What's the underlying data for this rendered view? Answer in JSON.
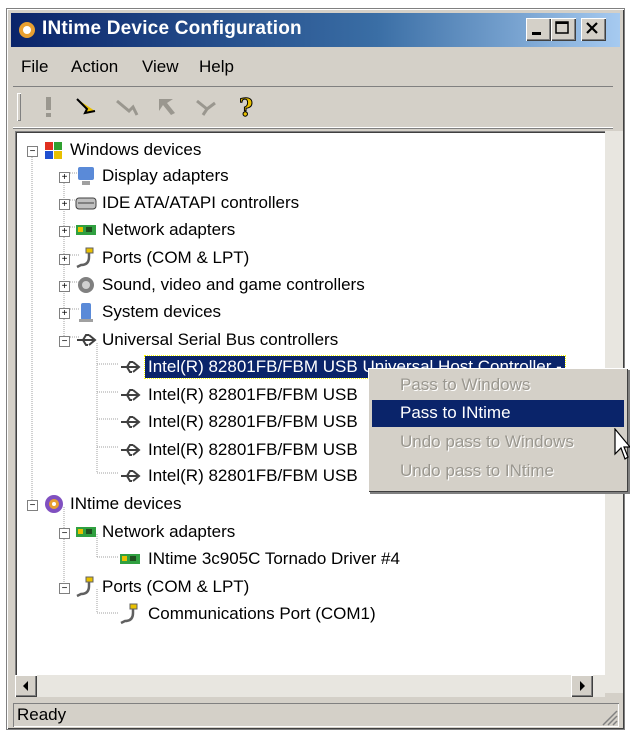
{
  "window": {
    "title": "INtime Device Configuration"
  },
  "menu": {
    "items": [
      "File",
      "Action",
      "View",
      "Help"
    ]
  },
  "toolbar": {
    "buttons": [
      "properties-icon",
      "enable-icon",
      "disable-icon",
      "back-icon",
      "forward-icon",
      "help-icon"
    ]
  },
  "tree": {
    "windows_root": "Windows devices",
    "display": "Display adapters",
    "ide": "IDE ATA/ATAPI controllers",
    "network": "Network adapters",
    "ports": "Ports (COM & LPT)",
    "sound": "Sound, video and game controllers",
    "system": "System devices",
    "usb": "Universal Serial Bus controllers",
    "usb_items": [
      "Intel(R) 82801FB/FBM USB Universal Host Controller -",
      "Intel(R) 82801FB/FBM USB",
      "Intel(R) 82801FB/FBM USB",
      "Intel(R) 82801FB/FBM USB",
      "Intel(R) 82801FB/FBM USB"
    ],
    "intime_root": "INtime devices",
    "intime_network": "Network adapters",
    "intime_nic": "INtime 3c905C Tornado Driver #4",
    "intime_ports": "Ports (COM & LPT)",
    "intime_com": "Communications Port (COM1)"
  },
  "context_menu": {
    "items": [
      "Pass to Windows",
      "Pass to INtime",
      "Undo pass to Windows",
      "Undo pass to INtime"
    ]
  },
  "status": {
    "text": "Ready"
  },
  "colors": {
    "title": "#0a246a",
    "face": "#d4d0c8",
    "highlight": "#0a246a"
  }
}
